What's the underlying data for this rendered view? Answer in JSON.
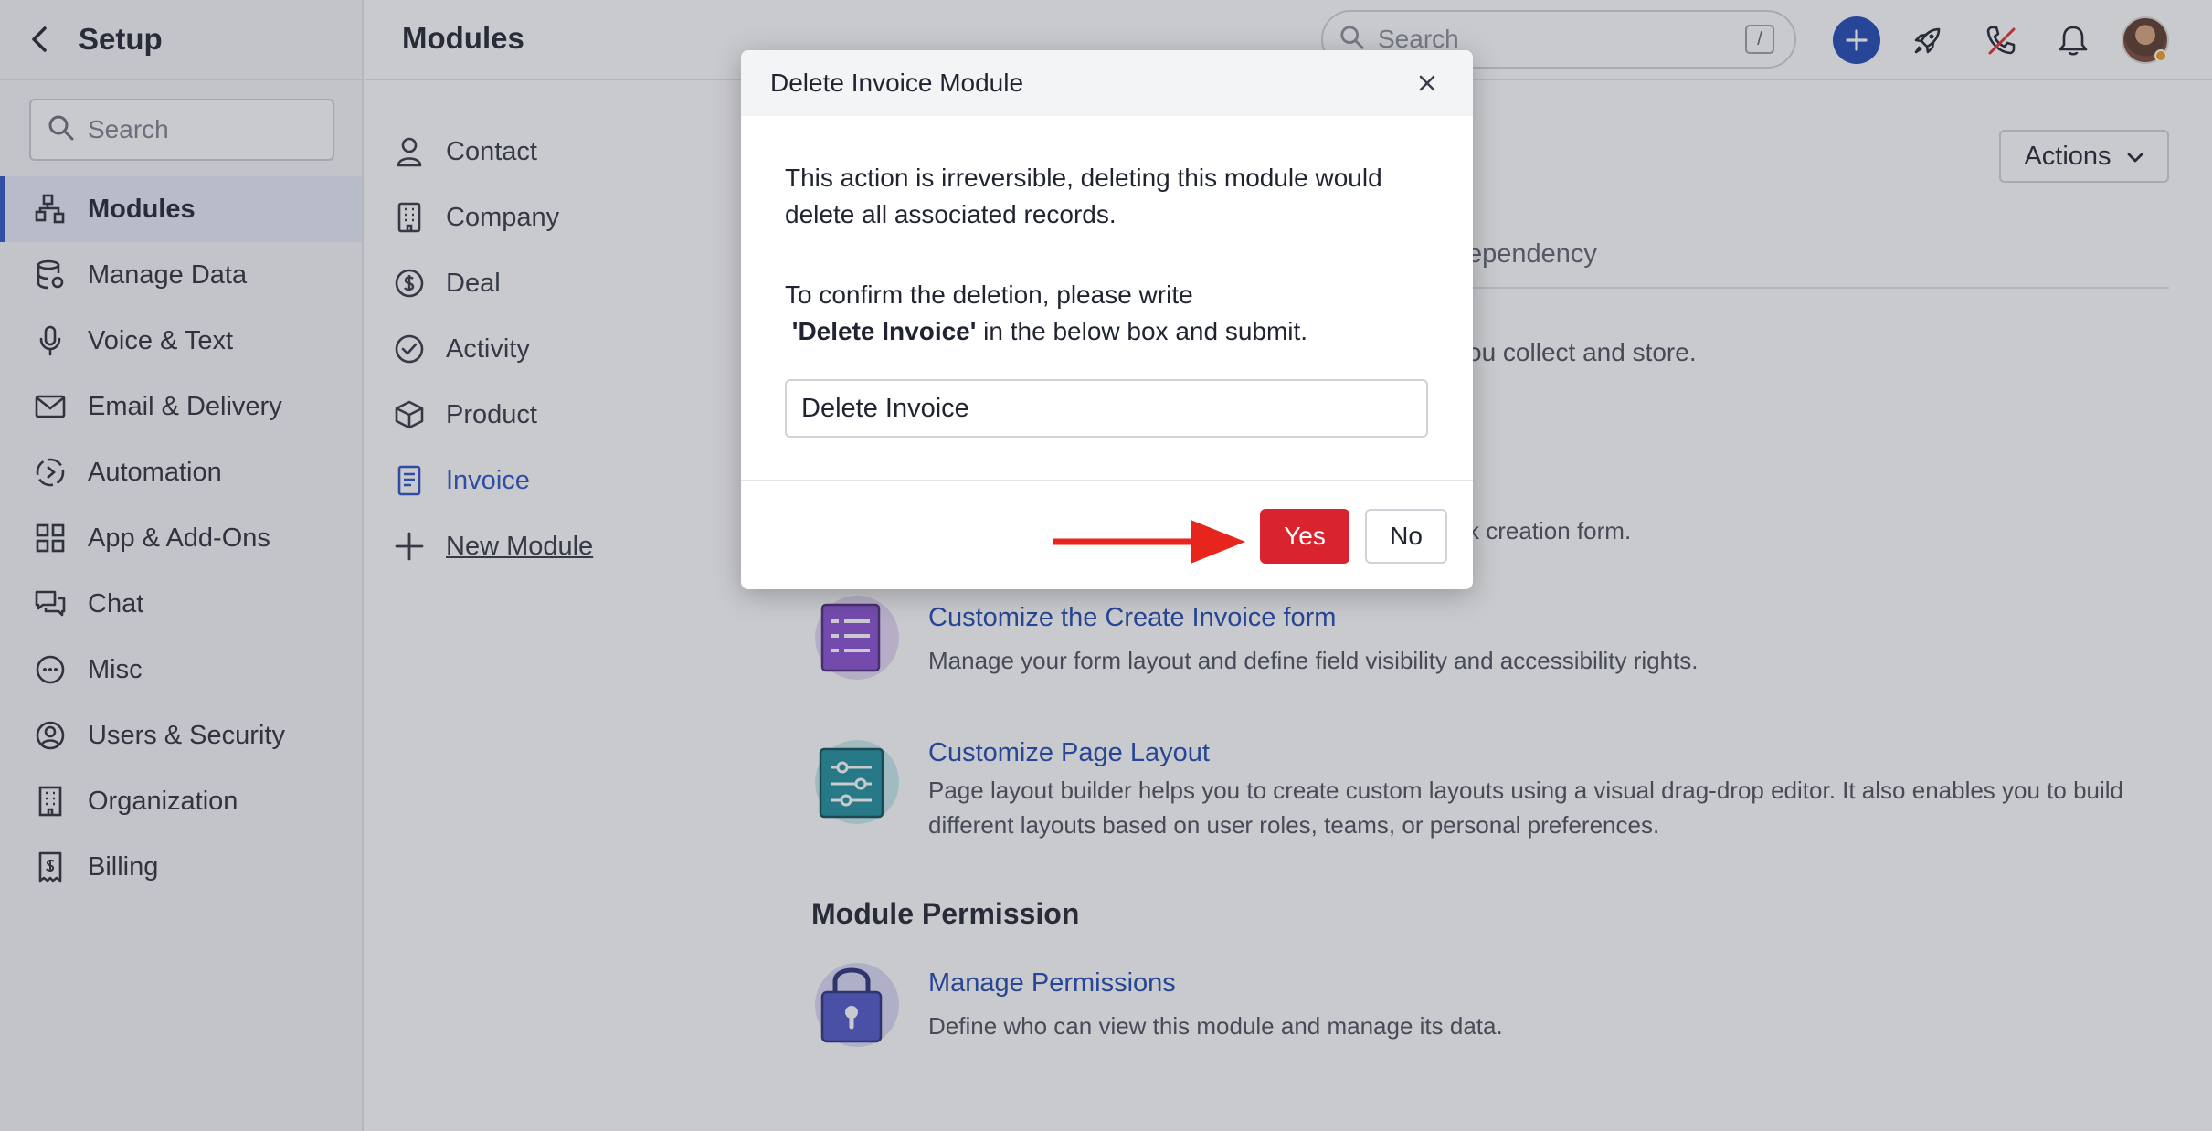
{
  "sidebar": {
    "title": "Setup",
    "search_placeholder": "Search",
    "items": [
      {
        "label": "Modules",
        "icon": "modules-icon"
      },
      {
        "label": "Manage Data",
        "icon": "database-icon"
      },
      {
        "label": "Voice & Text",
        "icon": "microphone-icon"
      },
      {
        "label": "Email & Delivery",
        "icon": "mail-icon"
      },
      {
        "label": "Automation",
        "icon": "automation-icon"
      },
      {
        "label": "App & Add-Ons",
        "icon": "apps-grid-icon"
      },
      {
        "label": "Chat",
        "icon": "chat-icon"
      },
      {
        "label": "Misc",
        "icon": "more-circle-icon"
      },
      {
        "label": "Users & Security",
        "icon": "user-circle-icon"
      },
      {
        "label": "Organization",
        "icon": "building-icon"
      },
      {
        "label": "Billing",
        "icon": "receipt-icon"
      }
    ]
  },
  "header": {
    "title": "Modules",
    "search_placeholder": "Search",
    "search_shortcut": "/"
  },
  "modules": {
    "items": [
      {
        "label": "Contact",
        "icon": "person-icon"
      },
      {
        "label": "Company",
        "icon": "building-icon"
      },
      {
        "label": "Deal",
        "icon": "dollar-circle-icon"
      },
      {
        "label": "Activity",
        "icon": "check-circle-icon"
      },
      {
        "label": "Product",
        "icon": "box-icon"
      },
      {
        "label": "Invoice",
        "icon": "invoice-icon"
      }
    ],
    "new_label": "New Module"
  },
  "main": {
    "actions_label": "Actions",
    "tab_partial": "ependency",
    "intro_partial": "ou collect and store.",
    "form_partial": "k creation form.",
    "features": [
      {
        "title": "Customize the Create Invoice form",
        "desc": "Manage your form layout and define field visibility and accessibility rights."
      },
      {
        "title": "Customize Page Layout",
        "desc": "Page layout builder helps you to create custom layouts using a visual drag-drop editor. It also enables you to build different layouts based on user roles, teams, or personal preferences."
      }
    ],
    "permission_section": "Module Permission",
    "permission": {
      "title": "Manage Permissions",
      "desc": "Define who can view this module and manage its data."
    }
  },
  "modal": {
    "title": "Delete Invoice Module",
    "text1": "This action is irreversible, deleting this module would delete all associated records.",
    "text2_prefix": "To confirm the deletion, please write",
    "text2_bold": "'Delete Invoice'",
    "text2_suffix": " in the below box and submit.",
    "input_value": "Delete Invoice",
    "yes_label": "Yes",
    "no_label": "No"
  },
  "colors": {
    "accent": "#2e55c4",
    "danger": "#d9242f",
    "arrow": "#e8251c"
  }
}
